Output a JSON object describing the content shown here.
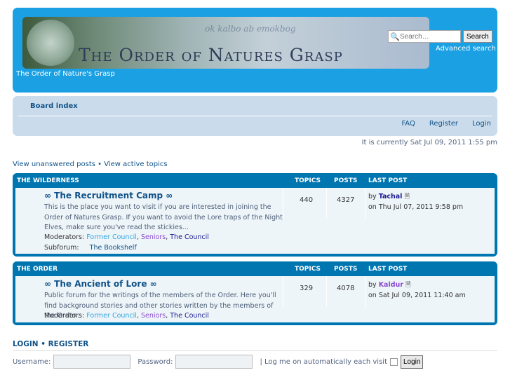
{
  "header": {
    "banner_title": "The Order of Natures Grasp",
    "banner_script": "ok kalbo ab emokbog",
    "site_description": "The Order of Nature's Grasp",
    "search_placeholder": "Search…",
    "search_button": "Search",
    "advanced_search": "Advanced search"
  },
  "nav": {
    "board_index": "Board index",
    "faq": "FAQ",
    "register": "Register",
    "login": "Login"
  },
  "time": "It is currently Sat Jul 09, 2011 1:55 pm",
  "quick_links": {
    "unanswered": "View unanswered posts",
    "sep": "•",
    "active": "View active topics"
  },
  "columns": {
    "topics": "TOPICS",
    "posts": "POSTS",
    "last_post": "LAST POST"
  },
  "categories": [
    {
      "name": "THE WILDERNESS",
      "forum": {
        "title": "∞ The Recruitment Camp ∞",
        "description": "This is the place you want to visit if you are interested in joining the Order of Natures Grasp. If you want to avoid the Lore traps of the Night Elves, make sure you've read the stickies...",
        "moderators_label": "Moderators:",
        "mods": [
          "Former Council",
          "Seniors",
          "The Council"
        ],
        "subforum_label": "Subforum:",
        "subforum": "The Bookshelf",
        "topics": "440",
        "posts": "4327",
        "by": "by",
        "last_author": "Tachal",
        "last_date": "on Thu Jul 07, 2011 9:58 pm"
      }
    },
    {
      "name": "THE ORDER",
      "forum": {
        "title": "∞ The Ancient of Lore ∞",
        "description": "Public forum for the writings of the members of the Order. Here you'll find background stories and other stories written by the members of the Order...",
        "moderators_label": "Moderators:",
        "mods": [
          "Former Council",
          "Seniors",
          "The Council"
        ],
        "topics": "329",
        "posts": "4078",
        "by": "by",
        "last_author": "Kaldur",
        "last_date": "on Sat Jul 09, 2011 11:40 am"
      }
    }
  ],
  "login": {
    "login": "LOGIN",
    "sep": "•",
    "register": "REGISTER",
    "username": "Username:",
    "password": "Password:",
    "auto": "| Log me on automatically each visit",
    "button": "Login"
  }
}
